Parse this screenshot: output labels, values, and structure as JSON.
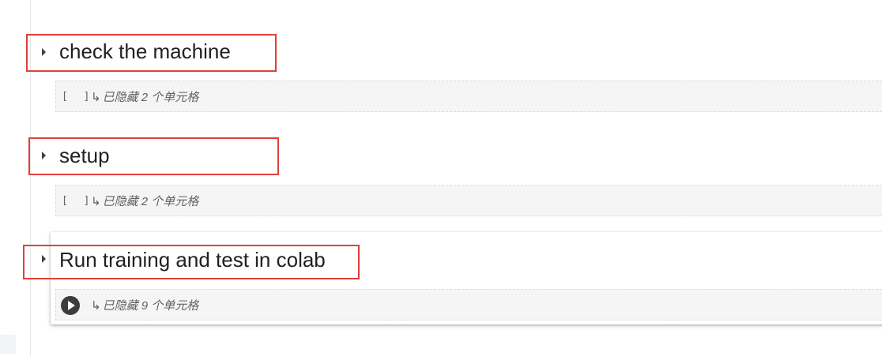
{
  "sections": [
    {
      "title": "check the machine",
      "hidden_cells": {
        "brackets": "[ ]",
        "arrow": "↳",
        "label": "已隐藏 2 个单元格"
      }
    },
    {
      "title": "setup",
      "hidden_cells": {
        "brackets": "[ ]",
        "arrow": "↳",
        "label": "已隐藏 2 个单元格"
      }
    },
    {
      "title": "Run training and test in colab",
      "hidden_cells": {
        "brackets": "",
        "arrow": "↳",
        "label": "已隐藏 9 个单元格"
      }
    }
  ],
  "icons": {
    "collapse_toggle": "caret-right-icon",
    "run": "play-circle-icon"
  },
  "colors": {
    "highlight_box": "#e0403a",
    "title_text": "#212121",
    "muted_text": "#616161",
    "hidden_cell_bg": "#f5f5f5"
  }
}
